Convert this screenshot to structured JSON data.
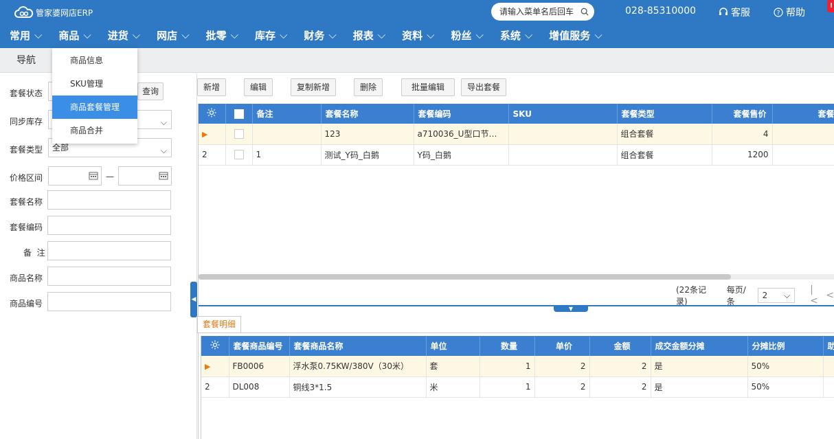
{
  "app": {
    "title": "管家婆网店ERP"
  },
  "search": {
    "placeholder": "请输入菜单名后回车"
  },
  "phone": "028-85310000",
  "toplinks": {
    "service": "客服",
    "help": "帮助",
    "badge": "!"
  },
  "menu": [
    "常用",
    "商品",
    "进货",
    "网店",
    "批零",
    "库存",
    "财务",
    "报表",
    "资料",
    "粉丝",
    "系统",
    "增值服务"
  ],
  "nav": {
    "tab": "导航"
  },
  "dropdown": [
    "商品信息",
    "SKU管理",
    "商品套餐管理",
    "商品合并"
  ],
  "filters": {
    "status_label": "套餐状态",
    "query_button": "查询",
    "sync_label": "同步库存",
    "type_label": "套餐类型",
    "type_value": "全部",
    "price_label": "价格区间",
    "price_sep": "—",
    "name_label": "套餐名称",
    "code_label": "套餐编码",
    "remark_label": "备  注",
    "goods_name_label": "商品名称",
    "goods_code_label": "商品编号"
  },
  "toolbar": [
    "新增",
    "编辑",
    "复制新增",
    "删除",
    "批量编辑",
    "导出套餐"
  ],
  "main_table": {
    "columns": [
      "备注",
      "套餐名称",
      "套餐编码",
      "SKU",
      "套餐类型",
      "套餐售价",
      "套餐成本金"
    ],
    "rows": [
      {
        "idx": "",
        "remark": "",
        "name": "123",
        "code": "a710036_U型口节能...",
        "sku": "",
        "type": "组合套餐",
        "price": "4",
        "cost": ""
      },
      {
        "idx": "2",
        "remark": "1",
        "name": "测试_Y码_白鹅",
        "code": "Y码_白鹅",
        "sku": "",
        "type": "组合套餐",
        "price": "1200",
        "cost": ""
      }
    ]
  },
  "pager": {
    "records": "(22条记录)",
    "per_page_label": "每页/条",
    "per_page": "2"
  },
  "detail": {
    "tab": "套餐明细",
    "columns": [
      "套餐商品编号",
      "套餐商品名称",
      "单位",
      "数量",
      "单价",
      "金额",
      "成交金额分摊",
      "分摊比例",
      "助"
    ],
    "rows": [
      {
        "idx": "",
        "code": "FB0006",
        "name": "浮水泵0.75KW/380V（30米）",
        "unit": "套",
        "qty": "1",
        "price": "2",
        "amount": "2",
        "split": "是",
        "ratio": "50%"
      },
      {
        "idx": "2",
        "code": "DL008",
        "name": "铜线3*1.5",
        "unit": "米",
        "qty": "1",
        "price": "2",
        "amount": "2",
        "split": "是",
        "ratio": "50%"
      }
    ]
  }
}
